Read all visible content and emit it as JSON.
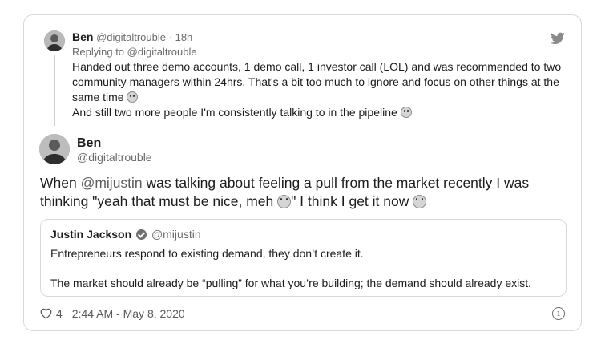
{
  "reply_tweet": {
    "name": "Ben",
    "handle": "@digitaltrouble",
    "separator": "·",
    "time": "18h",
    "replying_to": "Replying to @digitaltrouble",
    "text_line1": "Handed out three demo accounts, 1 demo call, 1 investor call (LOL) and was recommended to two community managers within 24hrs. That's a bit too much to ignore and focus on other things at the same time",
    "text_line2": "And still two more people I'm consistently talking to in the pipeline"
  },
  "main_tweet": {
    "name": "Ben",
    "handle": "@digitaltrouble",
    "text_part1": "When ",
    "mention": "@mijustin",
    "text_part2": " was talking about feeling a pull from the market recently I was thinking \"yeah that must be nice, meh ",
    "text_part3": "\" I think I get it now "
  },
  "quoted_tweet": {
    "name": "Justin Jackson",
    "handle": "@mijustin",
    "paragraph1": "Entrepreneurs respond to existing demand, they don’t create it.",
    "paragraph2": "The market should already be “pulling” for what you’re building; the demand should already exist."
  },
  "footer": {
    "likes": "4",
    "timestamp": "2:44 AM - May 8, 2020",
    "info": "i"
  },
  "icons": {
    "brand": "twitter-bird-icon",
    "like": "heart-icon",
    "info": "info-icon",
    "verified": "verified-badge-icon"
  }
}
